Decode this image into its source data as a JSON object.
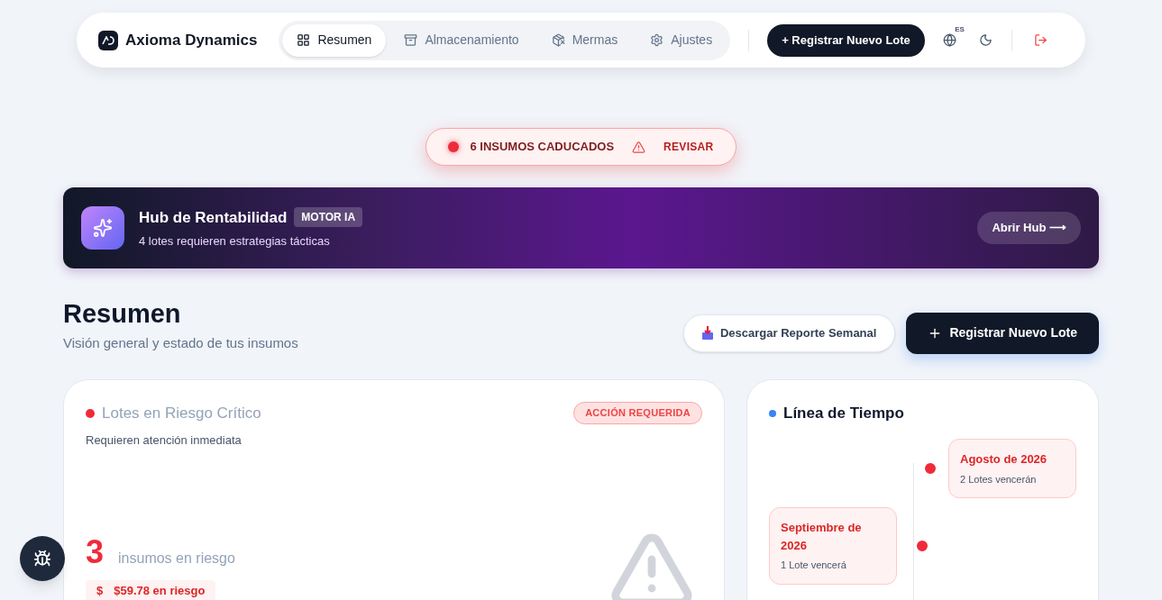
{
  "brand": {
    "name": "Axioma Dynamics"
  },
  "nav": [
    {
      "label": "Resumen",
      "selected": true
    },
    {
      "label": "Almacenamiento",
      "selected": false
    },
    {
      "label": "Mermas",
      "selected": false
    },
    {
      "label": "Ajustes",
      "selected": false
    }
  ],
  "header_actions": {
    "register_label": "+ Registrar Nuevo Lote",
    "language": "ES"
  },
  "alert": {
    "label": "6 INSUMOS CADUCADOS",
    "action": "REVISAR"
  },
  "hub": {
    "title": "Hub de Rentabilidad",
    "badge": "MOTOR IA",
    "subtitle": "4 lotes requieren estrategias tácticas",
    "button": "Abrir Hub ⟶"
  },
  "page": {
    "title": "Resumen",
    "subtitle": "Visión general y estado de tus insumos",
    "download_label": "Descargar Reporte Semanal",
    "register_label": "Registrar Nuevo Lote"
  },
  "risk_card": {
    "title": "Lotes en Riesgo Crítico",
    "badge": "ACCIÓN REQUERIDA",
    "subtitle": "Requieren atención inmediata",
    "count": "3",
    "count_label": "insumos en riesgo",
    "money_symbol": "$",
    "money": "$59.78 en riesgo"
  },
  "timeline": {
    "title": "Línea de Tiempo",
    "entries": [
      {
        "title": "Agosto de 2026",
        "detail": "2 Lotes vencerán"
      },
      {
        "title": "Septiembre de 2026",
        "detail": "1 Lote vencerá"
      }
    ]
  }
}
